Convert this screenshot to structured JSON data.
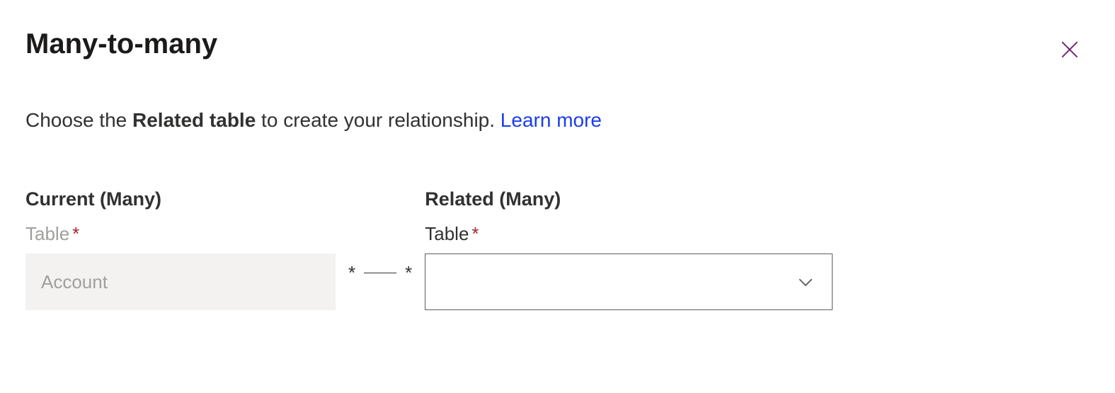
{
  "header": {
    "title": "Many-to-many"
  },
  "description": {
    "prefix": "Choose the ",
    "bold": "Related table",
    "suffix": " to create your relationship. ",
    "learn_more": "Learn more"
  },
  "form": {
    "current": {
      "group_label": "Current (Many)",
      "field_label": "Table",
      "required_marker": "*",
      "value": "Account"
    },
    "connector": {
      "left_star": "*",
      "right_star": "*"
    },
    "related": {
      "group_label": "Related (Many)",
      "field_label": "Table",
      "required_marker": "*",
      "value": ""
    }
  }
}
